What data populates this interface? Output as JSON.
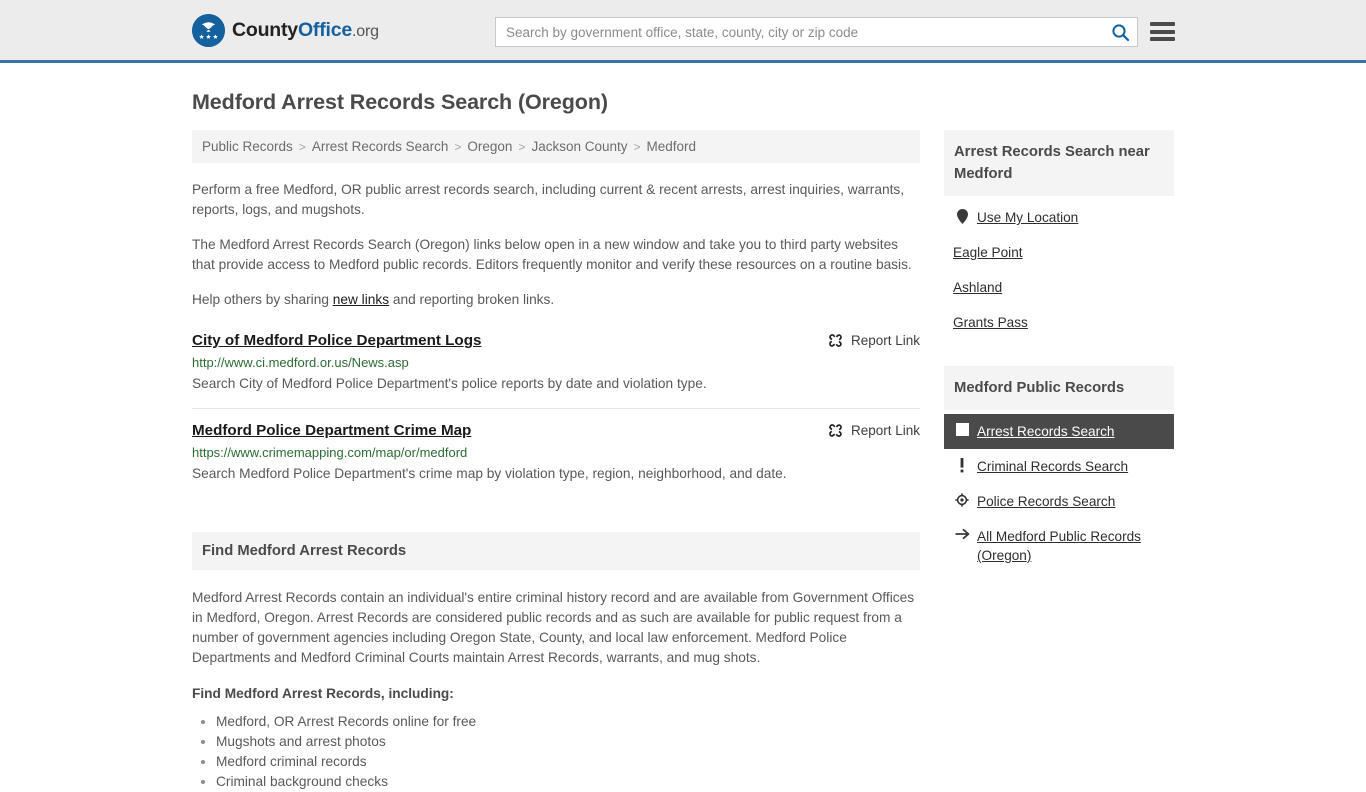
{
  "header": {
    "logo": {
      "part1": "County",
      "part2": "Office",
      "suffix": ".org",
      "icon": "eagle-star-badge-icon"
    },
    "search": {
      "placeholder": "Search by government office, state, county, city or zip code",
      "value": "",
      "button_icon": "search-icon"
    },
    "menu_icon": "hamburger-menu-icon"
  },
  "page": {
    "title": "Medford Arrest Records Search (Oregon)"
  },
  "breadcrumb": {
    "separator": ">",
    "items": [
      {
        "label": "Public Records"
      },
      {
        "label": "Arrest Records Search"
      },
      {
        "label": "Oregon"
      },
      {
        "label": "Jackson County"
      },
      {
        "label": "Medford"
      }
    ]
  },
  "intro": {
    "p1": "Perform a free Medford, OR public arrest records search, including current & recent arrests, arrest inquiries, warrants, reports, logs, and mugshots.",
    "p2": "The Medford Arrest Records Search (Oregon) links below open in a new window and take you to third party websites that provide access to Medford public records. Editors frequently monitor and verify these resources on a routine basis.",
    "p3_before": "Help others by sharing ",
    "p3_link": "new links",
    "p3_after": " and reporting broken links."
  },
  "results": {
    "report_label": "Report Link",
    "report_icon": "broken-link-icon",
    "items": [
      {
        "title": "City of Medford Police Department Logs",
        "url": "http://www.ci.medford.or.us/News.asp",
        "description": "Search City of Medford Police Department's police reports by date and violation type."
      },
      {
        "title": "Medford Police Department Crime Map",
        "url": "https://www.crimemapping.com/map/or/medford",
        "description": "Search Medford Police Department's crime map by violation type, region, neighborhood, and date."
      }
    ]
  },
  "find_section": {
    "heading": "Find Medford Arrest Records",
    "body": "Medford Arrest Records contain an individual's entire criminal history record and are available from Government Offices in Medford, Oregon. Arrest Records are considered public records and as such are available for public request from a number of government agencies including Oregon State, County, and local law enforcement. Medford Police Departments and Medford Criminal Courts maintain Arrest Records, warrants, and mug shots.",
    "list_heading": "Find Medford Arrest Records, including:",
    "list": [
      "Medford, OR Arrest Records online for free",
      "Mugshots and arrest photos",
      "Medford criminal records",
      "Criminal background checks"
    ]
  },
  "sidebar": {
    "near_card": {
      "title": "Arrest Records Search near Medford",
      "items": [
        {
          "label": "Use My Location",
          "icon": "location-pin-icon",
          "active": false
        },
        {
          "label": "Eagle Point",
          "icon": "",
          "active": false
        },
        {
          "label": "Ashland",
          "icon": "",
          "active": false
        },
        {
          "label": "Grants Pass",
          "icon": "",
          "active": false
        }
      ]
    },
    "records_card": {
      "title": "Medford Public Records",
      "items": [
        {
          "label": "Arrest Records Search",
          "icon": "arrest-card-icon",
          "active": true
        },
        {
          "label": "Criminal Records Search",
          "icon": "exclamation-icon",
          "active": false
        },
        {
          "label": "Police Records Search",
          "icon": "police-badge-icon",
          "active": false
        },
        {
          "label": "All Medford Public Records (Oregon)",
          "icon": "arrow-right-icon",
          "active": false
        }
      ]
    }
  },
  "colors": {
    "brand_blue": "#15619e",
    "header_border": "#3b72a4",
    "url_green": "#2d6b35",
    "active_bg": "#4a4a4a",
    "band_bg": "#f4f4f4"
  }
}
